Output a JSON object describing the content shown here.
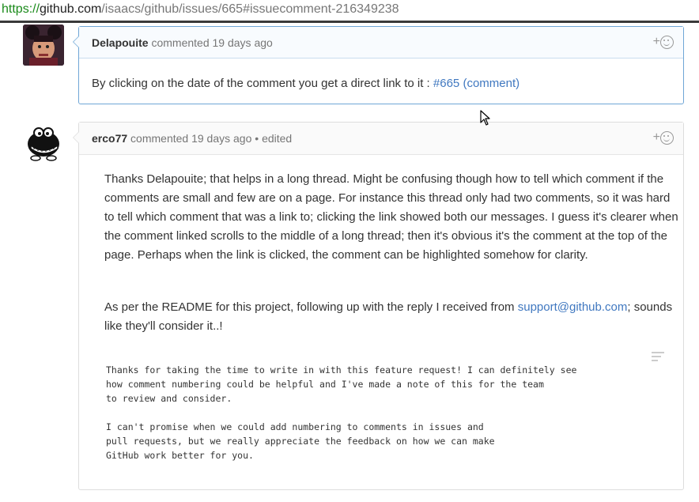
{
  "browser": {
    "url_scheme": "https://",
    "url_host": "github.com",
    "url_path": "/isaacs/github/issues/665#issuecomment-216349238"
  },
  "comments": [
    {
      "author": "Delapouite",
      "action": "commented",
      "time": "19 days ago",
      "body_prefix": "By clicking on the date of the comment you get a direct link to it :",
      "body_link": "#665 (comment)"
    },
    {
      "author": "erco77",
      "action": "commented",
      "time": "19 days ago",
      "edited": "• edited",
      "para1": "Thanks Delapouite; that helps in a long thread. Might be confusing though how to tell which comment if the comments are small and few are on a page. For instance this thread only had two comments, so it was hard to tell which comment that was a link to; clicking the link showed both our messages. I guess it's clearer when the comment linked scrolls to the middle of a long thread; then it's obvious it's the comment at the top of the page. Perhaps when the link is clicked, the comment can be highlighted somehow for clarity.",
      "para2_prefix": "As per the README for this project, following up with the reply I received from",
      "para2_link": "support@github.com",
      "para2_suffix": "; sounds like they'll consider it..!",
      "quote_lines_a": [
        "Thanks for taking the time to write in with this feature request! I can definitely see",
        "how comment numbering could be helpful and I've made a note of this for the team",
        "to review and consider."
      ],
      "quote_lines_b": [
        "I can't promise when we could add numbering to comments in issues and",
        "pull requests, but we really appreciate the feedback on how we can make",
        "GitHub work better for you."
      ]
    }
  ],
  "reaction_icon": "add-reaction-smiley-icon",
  "colors": {
    "link": "#4078c0",
    "highlight_border": "#6fa6d6",
    "url_scheme": "#1a8a1a"
  }
}
